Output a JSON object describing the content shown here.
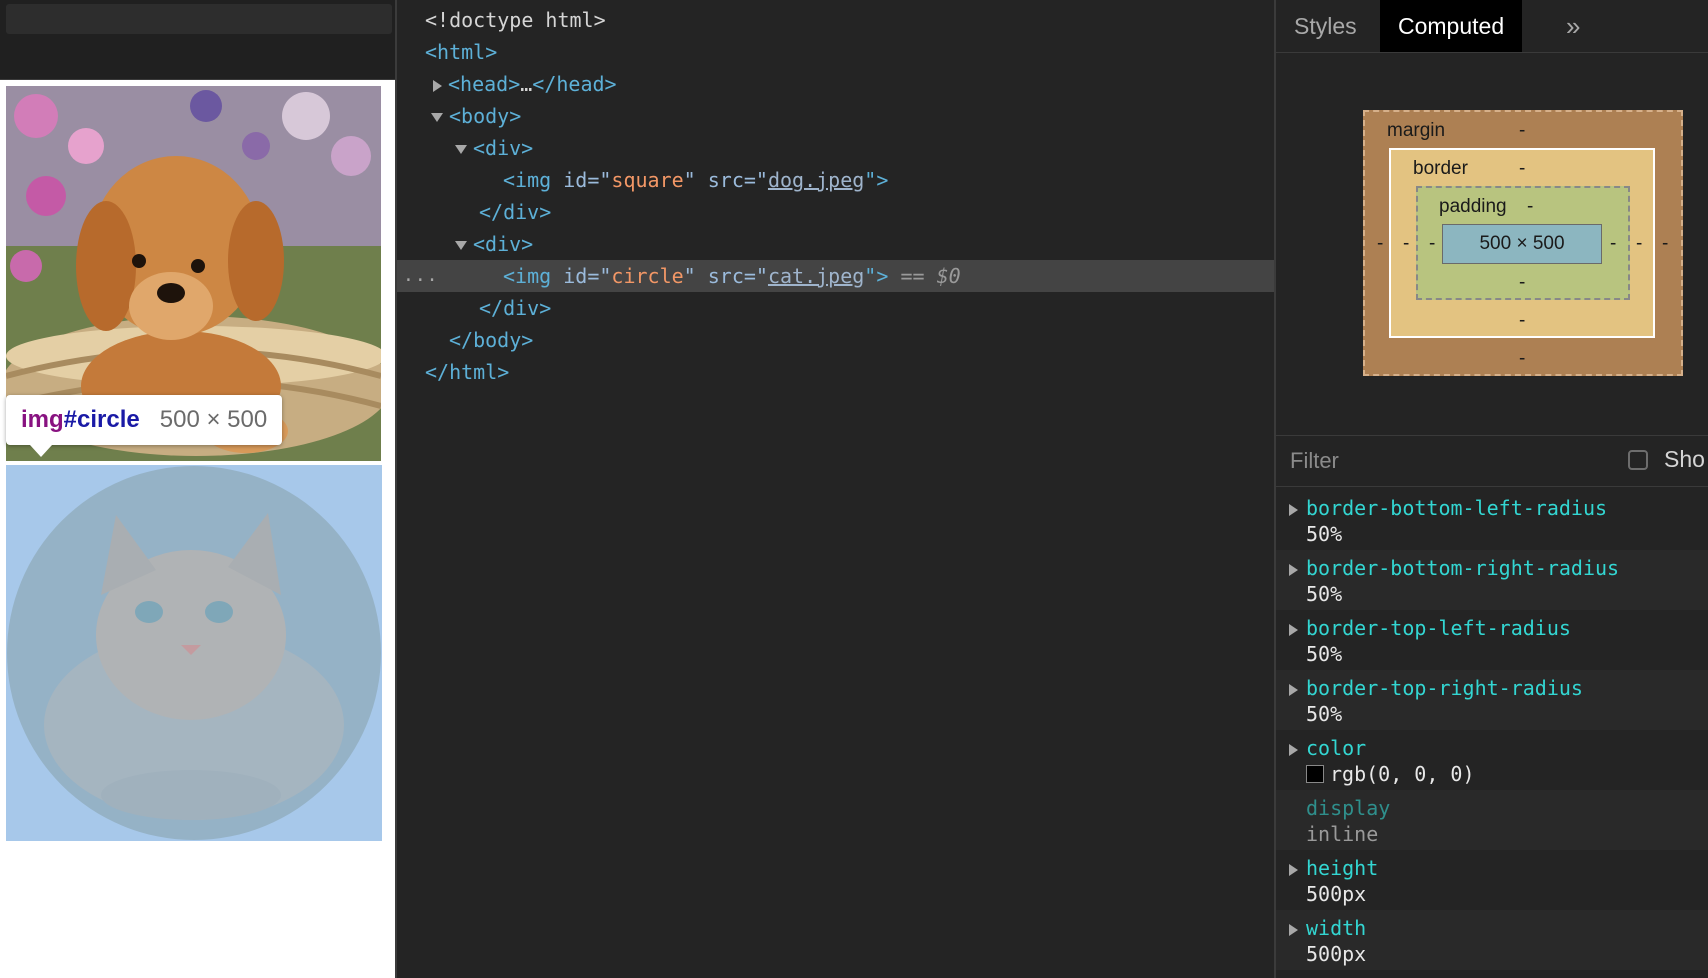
{
  "tooltip": {
    "tag": "img",
    "id": "#circle",
    "dims": "500 × 500"
  },
  "elements": {
    "lines": [
      {
        "text": "<!doctype html>"
      },
      {
        "open": "<html>"
      },
      {
        "open": "<head>",
        "ellipsis": "…",
        "close": "</head>"
      },
      {
        "open": "<body>"
      },
      {
        "open": "<div>"
      },
      {
        "tag": "<img",
        "attr1": "id",
        "eq": "=\"",
        "val1": "square",
        "q": "\"",
        "attr2": "src",
        "link": "dog.jpeg",
        "end": "\">"
      },
      {
        "close": "</div>"
      },
      {
        "open": "<div>"
      },
      {
        "tag": "<img",
        "attr1": "id",
        "eq": "=\"",
        "val1": "circle",
        "q": "\"",
        "attr2": "src",
        "link": "cat.jpeg",
        "end": "\">",
        "marker": "==",
        "ref": "$0"
      },
      {
        "close": "</div>"
      },
      {
        "close": "</body>"
      },
      {
        "close": "</html>"
      }
    ],
    "dots": "..."
  },
  "tabs": {
    "styles": "Styles",
    "computed": "Computed",
    "more": "»"
  },
  "boxmodel": {
    "margin_label": "margin",
    "border_label": "border",
    "padding_label": "padding",
    "content": "500 × 500",
    "dash": "-"
  },
  "filter": {
    "placeholder": "Filter",
    "checkbox_label": "Sho"
  },
  "computed": {
    "properties": [
      {
        "name": "border-bottom-left-radius",
        "value": "50%"
      },
      {
        "name": "border-bottom-right-radius",
        "value": "50%"
      },
      {
        "name": "border-top-left-radius",
        "value": "50%"
      },
      {
        "name": "border-top-right-radius",
        "value": "50%"
      },
      {
        "name": "color",
        "value": "rgb(0, 0, 0)",
        "swatch": "#000000"
      },
      {
        "name": "display",
        "value": "inline"
      },
      {
        "name": "height",
        "value": "500px"
      },
      {
        "name": "width",
        "value": "500px"
      }
    ]
  }
}
